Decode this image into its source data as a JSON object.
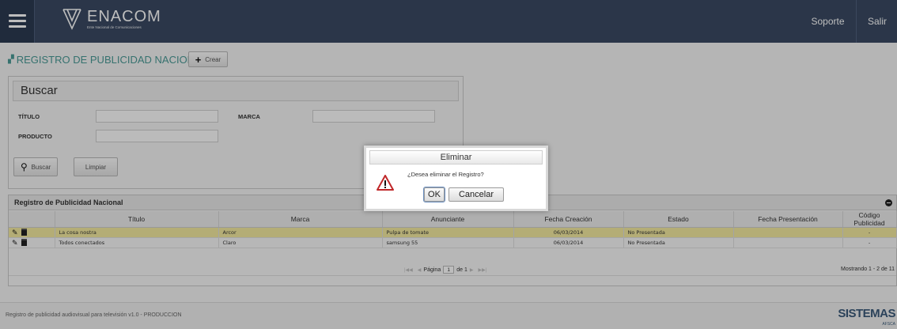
{
  "header": {
    "brand": "ENACOM",
    "brand_sub": "Ente Nacional de Comunicaciones",
    "nav": [
      "Soporte",
      "Salir"
    ]
  },
  "page": {
    "title": "REGISTRO DE PUBLICIDAD NACIONAL",
    "create_label": "Crear"
  },
  "search": {
    "heading": "Buscar",
    "fields": {
      "titulo_label": "TÍTULO",
      "marca_label": "MARCA",
      "producto_label": "PRODUCTO"
    },
    "values": {
      "titulo": "",
      "marca": "",
      "producto": ""
    },
    "search_button": "Buscar",
    "clear_button": "Limpiar"
  },
  "grid": {
    "caption": "Registro de Publicidad Nacional",
    "columns": [
      "",
      "Título",
      "Marca",
      "Anunciante",
      "Fecha Creación",
      "Estado",
      "Fecha Presentación",
      "Código Publicidad"
    ],
    "rows": [
      {
        "titulo": "La cosa nostra",
        "marca": "Arcor",
        "anunciante": "Pulpa de tomate",
        "fecha_creacion": "06/03/2014",
        "estado": "No Presentada",
        "fecha_presentacion": "",
        "codigo": "-"
      },
      {
        "titulo": "Todos conectados",
        "marca": "Claro",
        "anunciante": "samsung 55",
        "fecha_creacion": "06/03/2014",
        "estado": "No Presentada",
        "fecha_presentacion": "",
        "codigo": "-"
      }
    ],
    "pager": {
      "page_label": "Página",
      "page": "1",
      "of_label": "de 1",
      "showing": "Mostrando 1 - 2 de 11"
    }
  },
  "footer": {
    "text": "Registro de publicidad audiovisual para televisión v1.0 - PRODUCCION",
    "logo": "SISTEMAS",
    "logo_sub": "AFSCA"
  },
  "dialog": {
    "title": "Eliminar",
    "message": "¿Desea eliminar el Registro?",
    "ok": "OK",
    "cancel": "Cancelar"
  },
  "colors": {
    "topbar": "#3a4a63",
    "accent": "#4a9a96",
    "selected_row": "#f3ea9f"
  }
}
